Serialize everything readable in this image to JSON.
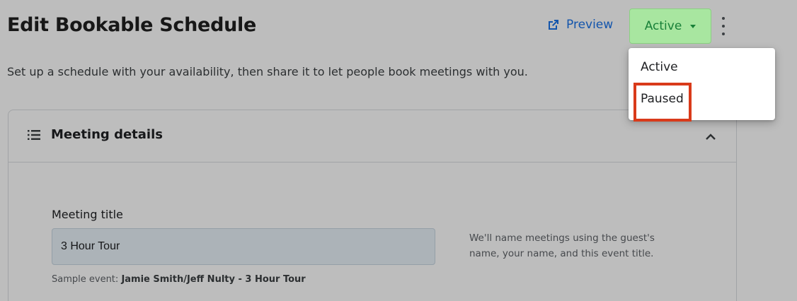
{
  "header": {
    "title": "Edit Bookable Schedule",
    "preview_label": "Preview",
    "status_label": "Active",
    "subtitle": "Set up a schedule with your availability, then share it to let people book meetings with you."
  },
  "card": {
    "title": "Meeting details",
    "field_label": "Meeting title",
    "input_value": "3 Hour Tour",
    "sample_prefix": "Sample event:",
    "sample_value": "Jamie Smith/Jeff Nulty - 3 Hour Tour",
    "hint": "We'll name meetings using the guest's name, your name, and this event title."
  },
  "status_menu": {
    "options": [
      "Active",
      "Paused"
    ],
    "highlighted": "Paused"
  },
  "icons": {
    "preview": "external-link-icon",
    "more": "more-vert-icon",
    "dropdown": "caret-down-icon",
    "section": "list-icon",
    "collapse": "chevron-up-icon"
  },
  "colors": {
    "accent": "#1a73e8",
    "status_bg": "#a8e6a0",
    "status_text": "#188038",
    "highlight": "#d93a1a"
  }
}
